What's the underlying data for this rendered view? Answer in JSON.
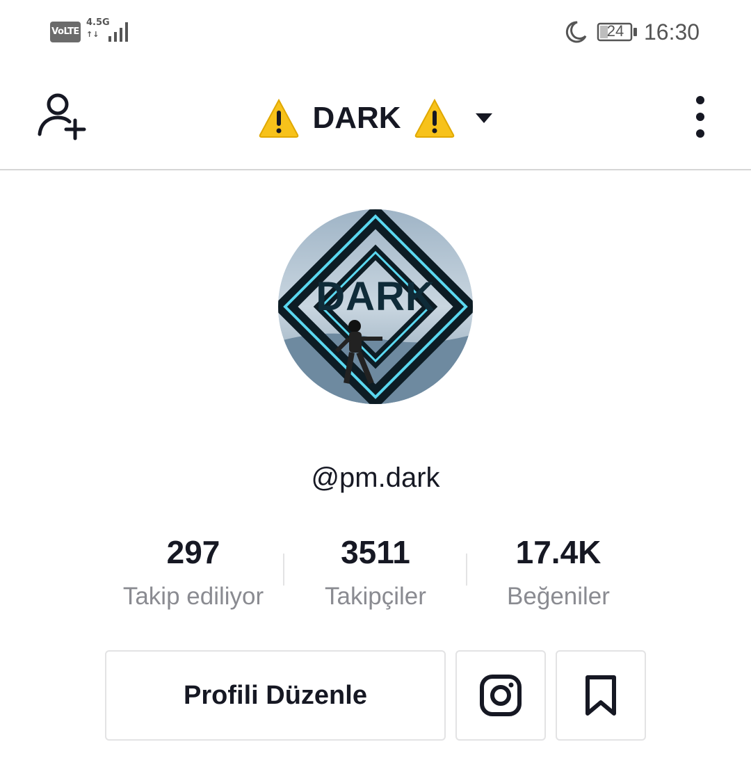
{
  "status_bar": {
    "volte": "VoLTE",
    "network": "4.5G",
    "network_arrows": "↑↓",
    "battery": "24",
    "time": "16:30"
  },
  "header": {
    "title": "DARK",
    "warning_emoji": "⚠️",
    "icons": [
      "add-user-icon",
      "warning-icon",
      "caret-down-icon",
      "more-vertical-icon"
    ]
  },
  "profile": {
    "avatar_text": "DARK",
    "username": "@pm.dark",
    "stats": [
      {
        "value": "297",
        "label": "Takip ediliyor"
      },
      {
        "value": "3511",
        "label": "Takipçiler"
      },
      {
        "value": "17.4K",
        "label": "Beğeniler"
      }
    ]
  },
  "actions": {
    "edit_profile": "Profili Düzenle",
    "icons": [
      "instagram-icon",
      "bookmark-icon"
    ]
  },
  "colors": {
    "text_primary": "#161823",
    "text_secondary": "#8a8b91",
    "border": "#e3e3e4",
    "warning_yellow": "#f7c21b"
  }
}
